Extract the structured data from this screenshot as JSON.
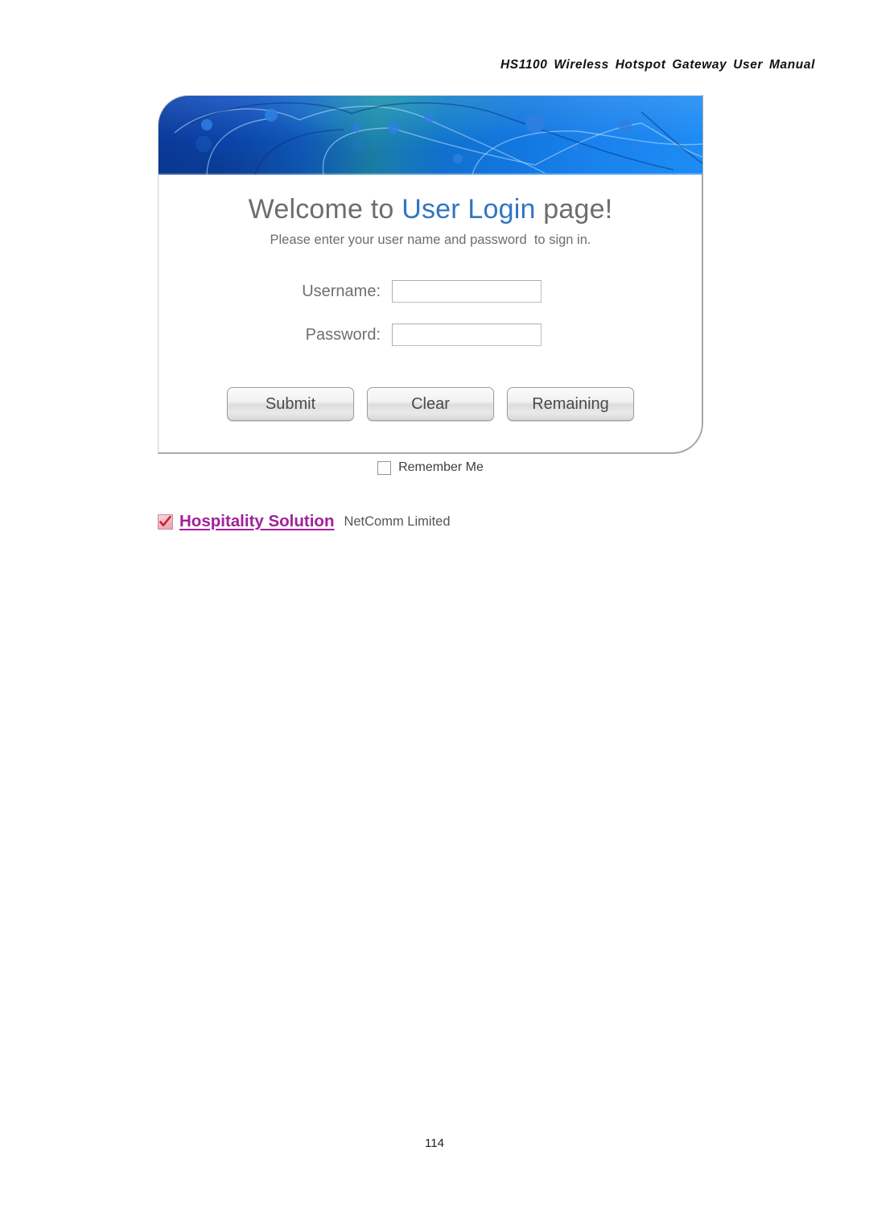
{
  "document": {
    "header_title": "HS1100 Wireless Hotspot Gateway User Manual",
    "page_number": "114"
  },
  "login_page": {
    "banner": {
      "icon_name": "network-nodes-graphic",
      "gradient_from": "#0b3fa8",
      "gradient_mid": "#1b7fa8",
      "gradient_to": "#1e8cf5"
    },
    "welcome": {
      "prefix": "Welcome to ",
      "highlight": "User Login",
      "suffix": " page!",
      "highlight_color": "#2f76c2",
      "text_color": "#6d6d6d"
    },
    "subtitle": "Please enter your user name and password  to sign in.",
    "fields": [
      {
        "label": "Username:",
        "value": "",
        "placeholder": ""
      },
      {
        "label": "Password:",
        "value": "",
        "placeholder": ""
      }
    ],
    "buttons": [
      {
        "label": "Submit"
      },
      {
        "label": "Clear"
      },
      {
        "label": "Remaining"
      }
    ],
    "remember_me": {
      "label": "Remember Me",
      "checked": false
    }
  },
  "footer": {
    "brand_icon_name": "red-check-mark-icon",
    "brand_title": "Hospitality Solution",
    "brand_title_color": "#a2219a",
    "company": "NetComm Limited"
  }
}
